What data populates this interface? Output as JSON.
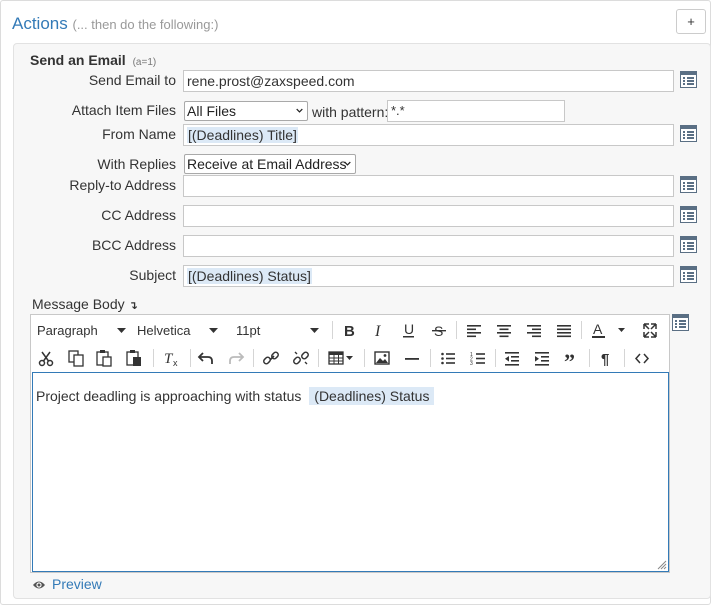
{
  "header": {
    "title": "Actions",
    "subtitle": "(... then do the following:)",
    "add_label": "+"
  },
  "section": {
    "title": "Send an Email",
    "index": "(a=1)"
  },
  "fields": {
    "send_to_label": "Send Email to",
    "send_to_value": "rene.prost@zaxspeed.com",
    "attach_label": "Attach Item Files",
    "attach_value": "All Files",
    "pattern_label": "with pattern:",
    "pattern_value": "*.*",
    "from_label": "From Name",
    "from_value": "[(Deadlines) Title]",
    "replies_label": "With Replies",
    "replies_value": "Receive at Email Address",
    "reply_to_label": "Reply-to Address",
    "reply_to_value": "",
    "cc_label": "CC Address",
    "cc_value": "",
    "bcc_label": "BCC Address",
    "bcc_value": "",
    "subject_label": "Subject",
    "subject_value": "[(Deadlines) Status]"
  },
  "body": {
    "label": "Message Body",
    "label_marker": "↴",
    "format_value": "Paragraph",
    "font_value": "Helvetica",
    "size_value": "11pt",
    "content_text": "Project deadling is approaching with status",
    "content_token": "(Deadlines) Status"
  },
  "toolbar_icons": [
    "bold-icon",
    "italic-icon",
    "underline-icon",
    "strikethrough-icon",
    "align-left-icon",
    "align-center-icon",
    "align-right-icon",
    "align-justify-icon",
    "text-color-icon",
    "fullscreen-icon",
    "cut-icon",
    "copy-icon",
    "paste-icon",
    "paste-text-icon",
    "clear-format-icon",
    "undo-icon",
    "redo-icon",
    "link-icon",
    "unlink-icon",
    "table-icon",
    "image-icon",
    "horizontal-rule-icon",
    "bullet-list-icon",
    "numbered-list-icon",
    "outdent-icon",
    "indent-icon",
    "blockquote-icon",
    "paragraph-mark-icon",
    "source-code-icon"
  ],
  "preview_label": "Preview",
  "colors": {
    "accent": "#337ab7",
    "token_bg": "#dce9f6",
    "panel_bg": "#f7f7f7",
    "muted": "#999999"
  }
}
